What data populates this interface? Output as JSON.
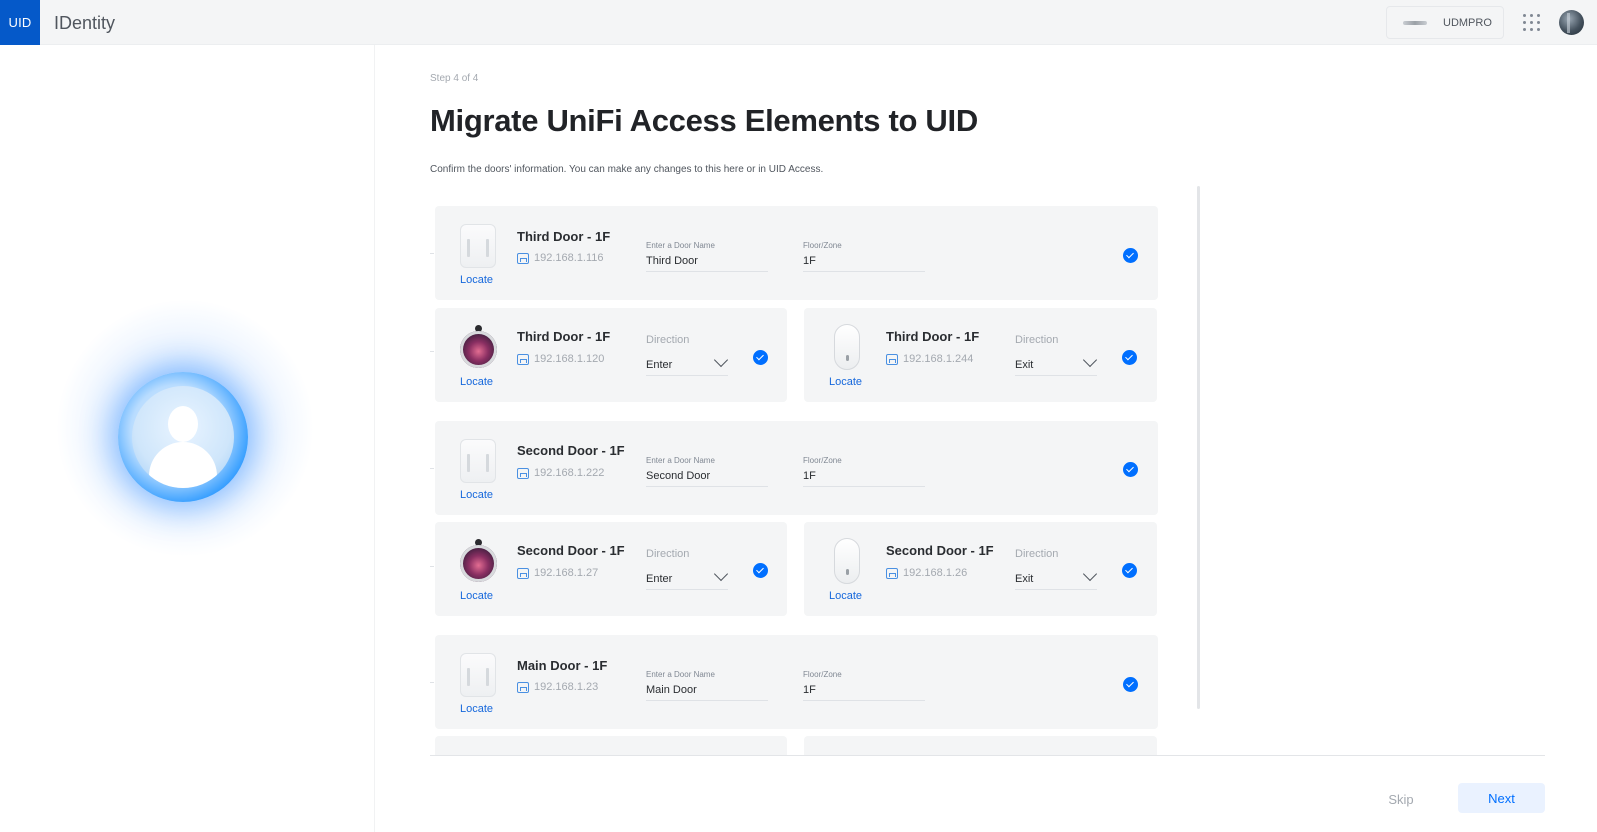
{
  "topbar": {
    "logo": "UID",
    "app_name": "IDentity",
    "device": "UDMPRO"
  },
  "page": {
    "step": "Step 4 of 4",
    "title": "Migrate UniFi Access Elements to UID",
    "description": "Confirm the doors' information. You can make any changes to this here or in UID Access."
  },
  "labels": {
    "locate": "Locate",
    "door_name": "Enter a Door Name",
    "floor_zone": "Floor/Zone",
    "direction": "Direction"
  },
  "doors": [
    {
      "hub": {
        "name": "Third Door - 1F",
        "ip": "192.168.1.116",
        "door_name": "Third Door",
        "floor": "1F"
      },
      "reader_in": {
        "name": "Third Door - 1F",
        "ip": "192.168.1.120",
        "direction": "Enter"
      },
      "reader_out": {
        "name": "Third Door - 1F",
        "ip": "192.168.1.244",
        "direction": "Exit"
      }
    },
    {
      "hub": {
        "name": "Second Door - 1F",
        "ip": "192.168.1.222",
        "door_name": "Second Door",
        "floor": "1F"
      },
      "reader_in": {
        "name": "Second Door - 1F",
        "ip": "192.168.1.27",
        "direction": "Enter"
      },
      "reader_out": {
        "name": "Second Door - 1F",
        "ip": "192.168.1.26",
        "direction": "Exit"
      }
    },
    {
      "hub": {
        "name": "Main Door - 1F",
        "ip": "192.168.1.23",
        "door_name": "Main Door",
        "floor": "1F"
      }
    }
  ],
  "footer": {
    "skip": "Skip",
    "next": "Next"
  },
  "colors": {
    "accent": "#006fff",
    "brand": "#0559c9",
    "card_bg": "#f4f5f6"
  }
}
